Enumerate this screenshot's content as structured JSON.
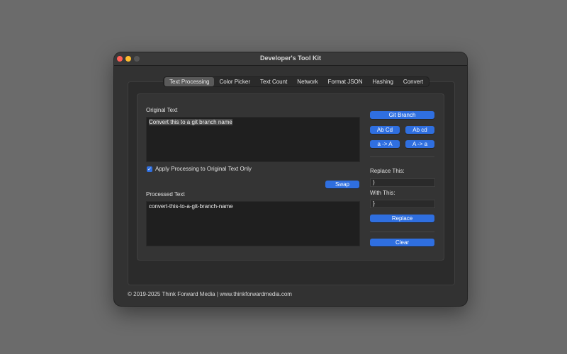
{
  "window": {
    "title": "Developer's Tool Kit"
  },
  "tabs": [
    {
      "label": "Text Processing",
      "selected": true
    },
    {
      "label": "Color Picker",
      "selected": false
    },
    {
      "label": "Text Count",
      "selected": false
    },
    {
      "label": "Network",
      "selected": false
    },
    {
      "label": "Format JSON",
      "selected": false
    },
    {
      "label": "Hashing",
      "selected": false
    },
    {
      "label": "Convert",
      "selected": false
    }
  ],
  "original": {
    "label": "Original Text",
    "value": "Convert this to a git branch name"
  },
  "apply_checkbox": {
    "label": "Apply Processing to Original Text Only",
    "checked": true,
    "check_glyph": "✓"
  },
  "swap_label": "Swap",
  "processed": {
    "label": "Processed Text",
    "value": "convert-this-to-a-git-branch-name"
  },
  "buttons": {
    "git_branch": "Git Branch",
    "title_case": "Ab Cd",
    "sentence_case": "Ab cd",
    "uppercase": "a -> A",
    "lowercase": "A -> a",
    "replace": "Replace",
    "clear": "Clear"
  },
  "replace": {
    "replace_label": "Replace This:",
    "replace_value": ")",
    "with_label": "With This:",
    "with_value": "}"
  },
  "footer": "© 2019-2025 Think Forward Media | www.thinkforwardmedia.com",
  "colors": {
    "accent": "#2f6fe0",
    "desktop": "#6b6b6b",
    "window": "#323232"
  }
}
